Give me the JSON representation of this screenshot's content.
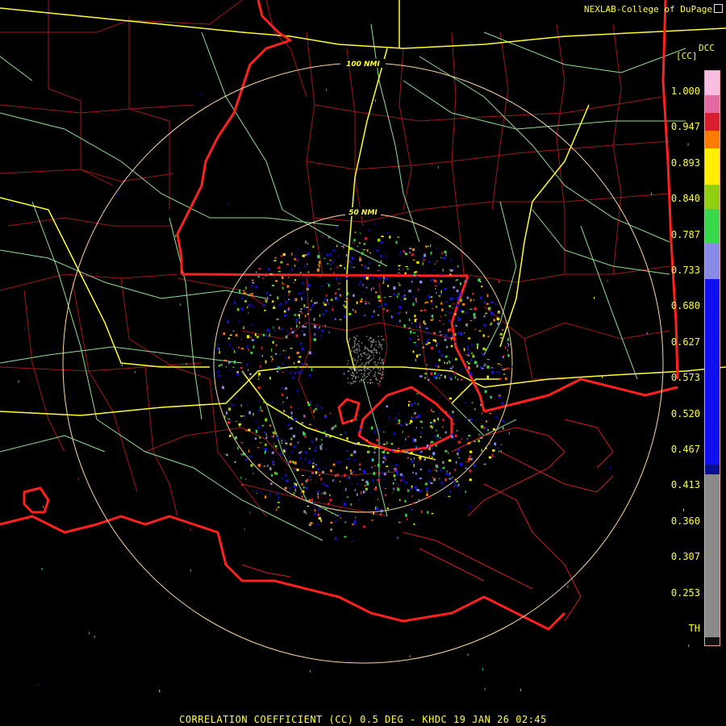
{
  "header": {
    "credit": "NEXLAB-College of DuPage"
  },
  "legend": {
    "product_code": "DCC",
    "unit": "[CC]",
    "ticks": [
      "1.000",
      "0.947",
      "0.893",
      "0.840",
      "0.787",
      "0.733",
      "0.680",
      "0.627",
      "0.573",
      "0.520",
      "0.467",
      "0.413",
      "0.360",
      "0.307",
      "0.253",
      "TH"
    ],
    "colors": {
      "top": "#f9bde0",
      "pink": "#e36aa3",
      "red": "#d81e2f",
      "orange": "#ff7a00",
      "yellow": "#ffee00",
      "lime": "#90d010",
      "green": "#37d84a",
      "lavender": "#8a8ae8",
      "blue": "#1010f0",
      "navy": "#0a1090",
      "gray": "#8a8a8a",
      "bottom": "#101010"
    }
  },
  "map": {
    "range_rings": [
      "50 NMI",
      "100 NMI"
    ],
    "colors": {
      "state_border": "#ff2020",
      "county_border": "#a01818",
      "interstate": "#ffff33",
      "highway": "#90e090",
      "range_ring": "#ffd8a0"
    }
  },
  "footer": {
    "caption": "CORRELATION COEFFICIENT (CC) 0.5 DEG - KHDC 19 JAN 26 02:45"
  }
}
